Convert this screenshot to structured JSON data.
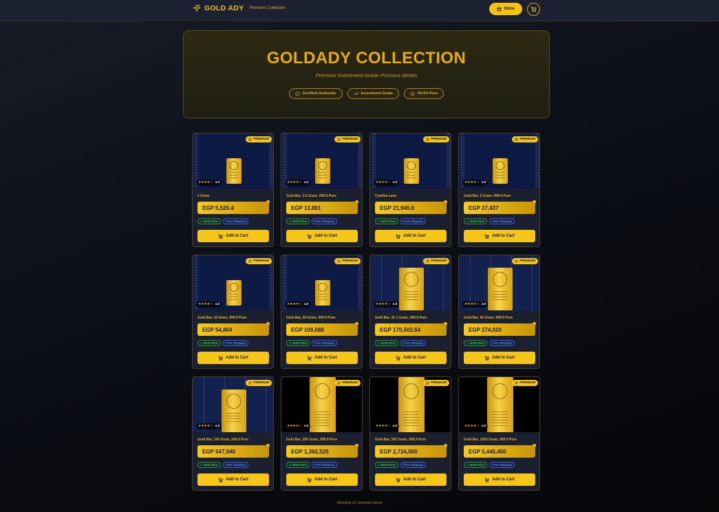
{
  "header": {
    "brand_name": "GOLD ADY",
    "brand_subtitle": "Premium Collection",
    "store_label": "Store"
  },
  "hero": {
    "title": "GOLDADY COLLECTION",
    "subtitle": "Premium Investment-Grade Precious Metals",
    "badges": [
      "Certified Authentic",
      "Investment Grade",
      "99.9% Pure"
    ]
  },
  "common": {
    "premium_label": "PREMIUM",
    "tag_best_price": "✓ Best Price",
    "tag_free_shipping": "Free Shipping",
    "add_to_cart": "Add to Cart",
    "rating": "4.8"
  },
  "products": [
    {
      "name": "1 Gram",
      "price": "EGP 5,520.4",
      "image_style": "navy-bar"
    },
    {
      "name": "Gold Bar, 2.5 Gram, 999.9 Pure",
      "price": "EGP 13,801",
      "image_style": "navy-bar"
    },
    {
      "name": "Cynthia Lane",
      "price": "EGP 21,945.6",
      "image_style": "navy-bar"
    },
    {
      "name": "Gold Bar, 5 Gram, 999.9 Pure",
      "price": "EGP 27,437",
      "image_style": "navy-bar"
    },
    {
      "name": "Gold Bar, 10 Gram, 999.9 Pure",
      "price": "EGP 54,864",
      "image_style": "navy-bar"
    },
    {
      "name": "Gold Bar, 20 Gram, 999.9 Pure",
      "price": "EGP 109,688",
      "image_style": "navy-bar"
    },
    {
      "name": "Gold Bar, 31.1 Gram, 999.9 Pure",
      "price": "EGP 170,502.64",
      "image_style": "patterned-bar"
    },
    {
      "name": "Gold Bar, 50 Gram, 999.9 Pure",
      "price": "EGP 274,020",
      "image_style": "patterned-bar"
    },
    {
      "name": "Gold Bar, 100 Gram, 999.9 Pure",
      "price": "EGP 547,940",
      "image_style": "patterned-bar"
    },
    {
      "name": "Gold Bar, 250 Gram, 999.9 Pure",
      "price": "EGP 1,362,525",
      "image_style": "black-bar"
    },
    {
      "name": "Gold Bar, 500 Gram, 999.9 Pure",
      "price": "EGP 2,724,000",
      "image_style": "black-bar"
    },
    {
      "name": "Gold Bar, 1000 Gram, 999.9 Pure",
      "price": "EGP 5,445,450",
      "image_style": "black-bar"
    }
  ],
  "footer": {
    "showing_text": "Showing 12 premium items"
  },
  "colors": {
    "accent_gold": "#f5c518",
    "background": "#0c0f16",
    "card_bg": "#1a2030"
  }
}
